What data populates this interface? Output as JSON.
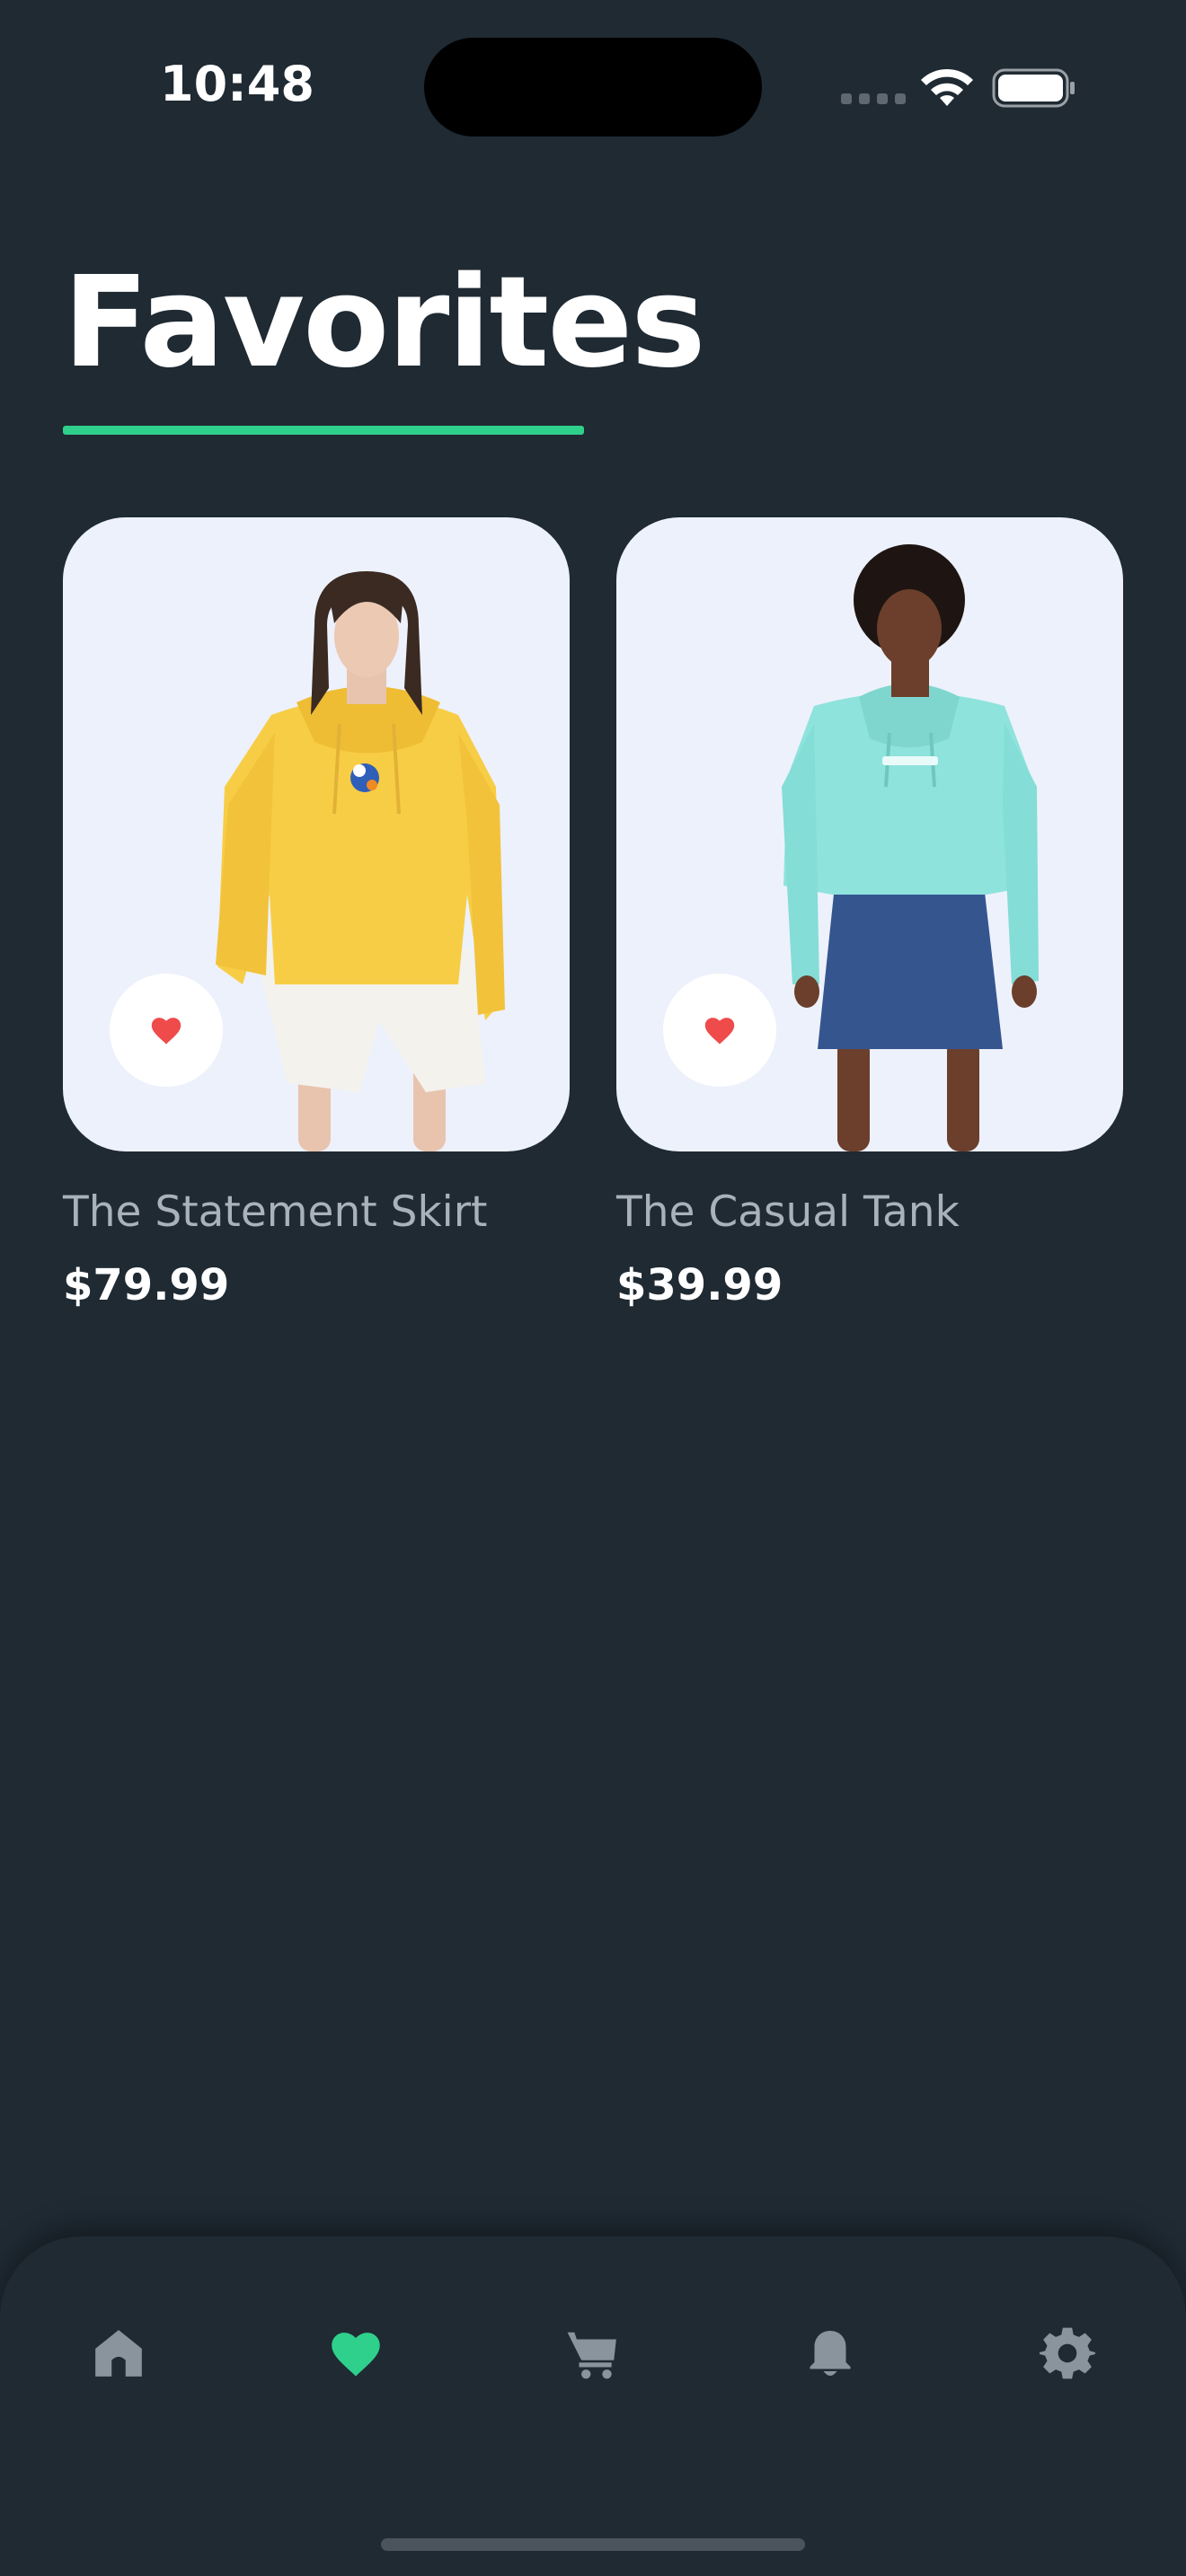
{
  "status_bar": {
    "time": "10:48"
  },
  "page": {
    "title": "Favorites",
    "accent_color": "#2fd08c",
    "background_color": "#1f2a33"
  },
  "favorites": [
    {
      "name": "The Statement Skirt",
      "price": "$79.99",
      "favorited": true,
      "image": "woman in yellow hoodie and white shorts"
    },
    {
      "name": "The Casual Tank",
      "price": "$39.99",
      "favorited": true,
      "image": "woman in mint hoodie and denim skirt"
    }
  ],
  "bottom_nav": {
    "items": [
      {
        "icon": "home-icon",
        "active": false
      },
      {
        "icon": "heart-icon",
        "active": true
      },
      {
        "icon": "cart-icon",
        "active": false
      },
      {
        "icon": "bell-icon",
        "active": false
      },
      {
        "icon": "gear-icon",
        "active": false
      }
    ],
    "active_color": "#2fd08c",
    "inactive_color": "#8a949c"
  }
}
